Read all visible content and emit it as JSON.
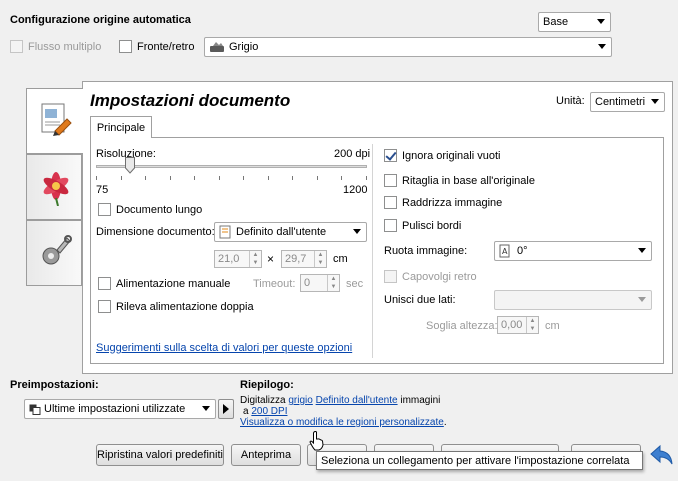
{
  "header": {
    "profile_title": "Configurazione origine automatica",
    "mode_value": "Base",
    "multi_flow_label": "Flusso multiplo",
    "duplex_label": "Fronte/retro",
    "color_value": "Grigio"
  },
  "panel": {
    "title": "Impostazioni documento",
    "units_label": "Unità:",
    "units_value": "Centimetri",
    "tab_main": "Principale"
  },
  "left": {
    "resolution_label": "Risoluzione:",
    "resolution_value": "200 dpi",
    "slider_min": "75",
    "slider_max": "1200",
    "slider_fraction": 0.112,
    "long_doc_label": "Documento lungo",
    "doc_size_label": "Dimensione documento:",
    "doc_size_value": "Definito dall'utente",
    "width_value": "21,0",
    "times": "×",
    "height_value": "29,7",
    "unit_cm": "cm",
    "manual_feed_label": "Alimentazione manuale",
    "timeout_label": "Timeout:",
    "timeout_value": "0",
    "timeout_unit": "sec",
    "double_feed_label": "Rileva alimentazione doppia",
    "hint_link": "Suggerimenti sulla scelta di valori per queste opzioni"
  },
  "right": {
    "skip_blank_label": "Ignora originali vuoti",
    "crop_label": "Ritaglia in base all'originale",
    "straighten_label": "Raddrizza immagine",
    "clean_edges_label": "Pulisci bordi",
    "rotate_label": "Ruota immagine:",
    "rotate_value": "0°",
    "flip_label": "Capovolgi retro",
    "merge_label": "Unisci due lati:",
    "merge_value": "",
    "threshold_label": "Soglia altezza:",
    "threshold_value": "0,00",
    "threshold_unit": "cm"
  },
  "presets": {
    "label": "Preimpostazioni:",
    "value": "Ultime impostazioni utilizzate"
  },
  "summary": {
    "label": "Riepilogo:",
    "line1_prefix": "Digitalizza ",
    "color_link": "grigio",
    "size_link": "Definito dall'utente",
    "line1_suffix": " immagini",
    "line2_prefix": "a ",
    "dpi_link": "200 DPI",
    "regions_link": "Visualizza o modifica le regioni personalizzate",
    "regions_suffix": "."
  },
  "buttons": {
    "reset": "Ripristina valori predefiniti",
    "preview": "Anteprima"
  },
  "tooltip": "Seleziona un collegamento per attivare l'impostazione correlata",
  "colors": {
    "link": "#0645ad",
    "accent_back_arrow": "#3d7fd0"
  }
}
